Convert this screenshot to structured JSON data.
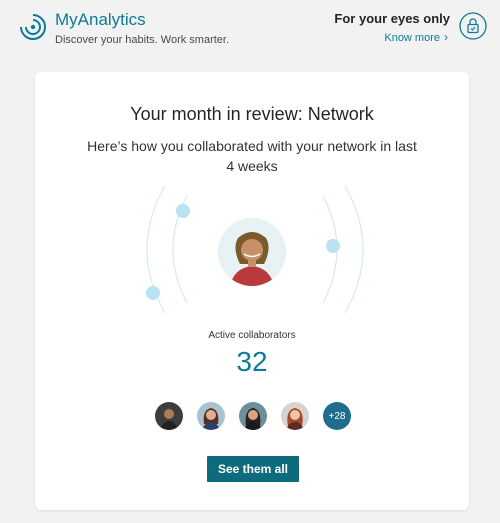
{
  "header": {
    "app_title": "MyAnalytics",
    "tagline": "Discover your habits. Work smarter.",
    "privacy_title": "For your eyes only",
    "know_more": "Know more"
  },
  "card": {
    "title": "Your month in review: Network",
    "subtitle": "Here’s how you collaborated with your network in last 4 weeks",
    "metric_label": "Active collaborators",
    "metric_value": "32",
    "more_collaborators": "+28",
    "cta_label": "See them all"
  },
  "colors": {
    "accent": "#0f7a97",
    "button": "#0e6b7b",
    "badge": "#1f6d8c",
    "orbit_dot": "#b9e3f1",
    "background": "#f2f2f2"
  },
  "icons": {
    "logo": "myanalytics-logo-icon",
    "privacy": "lock-shield-icon",
    "chevron": "chevron-right-icon"
  }
}
